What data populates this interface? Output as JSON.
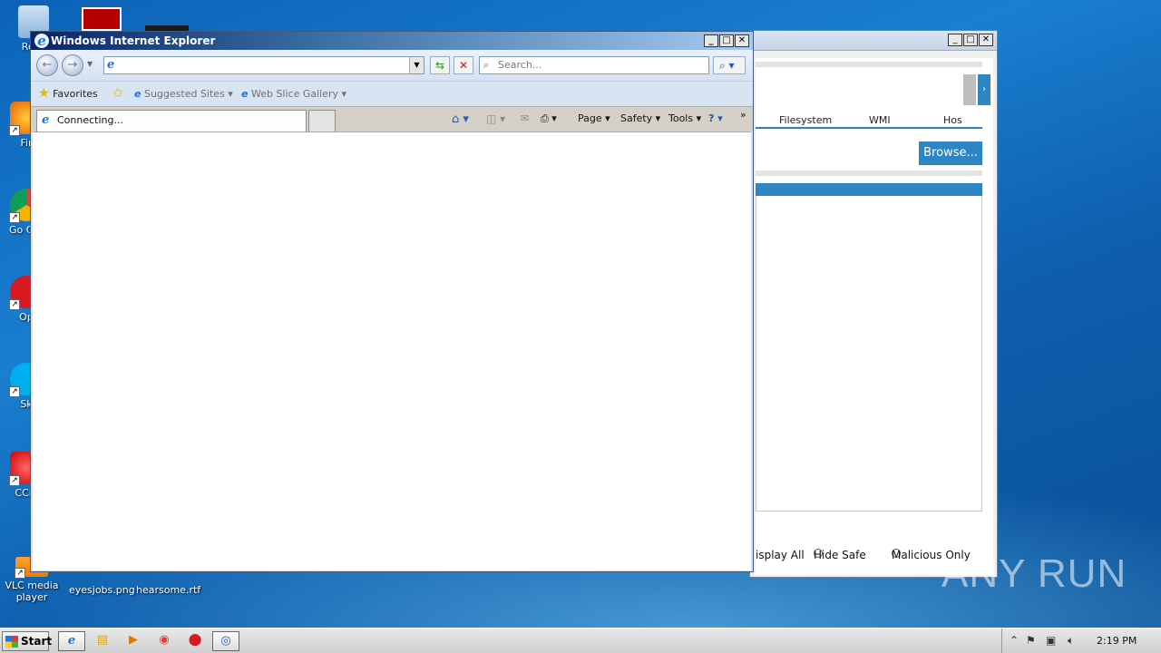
{
  "desktop": {
    "icons": [
      {
        "label": "Recy",
        "id": "recycle"
      },
      {
        "label": "Fir",
        "id": "firefox"
      },
      {
        "label": "Go Chr",
        "id": "chrome"
      },
      {
        "label": "Op",
        "id": "opera"
      },
      {
        "label": "Sk",
        "id": "skype"
      },
      {
        "label": "CCle",
        "id": "ccleaner"
      },
      {
        "label": "VLC media player",
        "id": "vlc"
      },
      {
        "label": "eyesjobs.png",
        "id": "file-png"
      },
      {
        "label": "hearsome.rtf",
        "id": "file-rtf"
      }
    ]
  },
  "bg_window": {
    "tabs": [
      "Filesystem",
      "WMI",
      "Hos"
    ],
    "browse_label": "Browse...",
    "radio_options": [
      "isplay All",
      "Hide Safe",
      "Malicious Only"
    ]
  },
  "ie": {
    "title": "Windows Internet Explorer",
    "search_placeholder": "Search...",
    "favorites": {
      "favorites_label": "Favorites",
      "suggested_label": "Suggested Sites",
      "webslice_label": "Web Slice Gallery"
    },
    "tab_label": "Connecting...",
    "commands": {
      "page": "Page",
      "safety": "Safety",
      "tools": "Tools"
    }
  },
  "taskbar": {
    "start_label": "Start",
    "clock": "2:19 PM"
  },
  "watermark": "ANY RUN",
  "colors": {
    "accent_blue": "#2d86c1",
    "titlebar_dark": "#0a246a"
  }
}
